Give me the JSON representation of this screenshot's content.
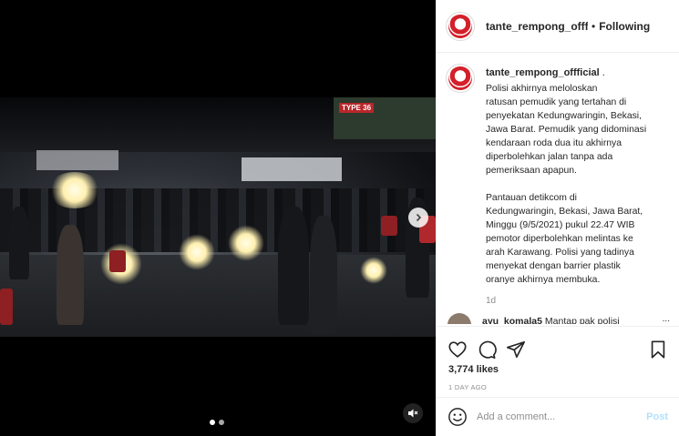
{
  "header": {
    "username": "tante_rempong_offficial",
    "separator": "•",
    "follow_status": "Following"
  },
  "caption": {
    "username": "tante_rempong_offficial",
    "suffix": " .",
    "text": "Polisi akhirnya meloloskan\nratusan pemudik yang tertahan di\npenyekatan Kedungwaringin, Bekasi,\nJawa Barat. Pemudik yang didominasi\nkendaraan roda dua itu akhirnya\ndiperbolehkan jalan tanpa ada\npemeriksaan apapun.\n\nPantauan detikcom di\nKedungwaringin, Bekasi, Jawa Barat,\nMinggu (9/5/2021) pukul 22.47 WIB\npemotor diperbolehkan melintas ke\narah Karawang. Polisi yang tadinya\nmenyekat dengan barrier plastik\noranye akhirnya membuka.",
    "time": "1d"
  },
  "comment_preview": {
    "username": "ayu_komala5",
    "text": "Mantap pak polisi",
    "more": "..."
  },
  "video": {
    "sign_text": "TYPE 36"
  },
  "actions": {
    "likes": "3,774 likes",
    "time_ago": "1 DAY AGO"
  },
  "comment_box": {
    "placeholder": "Add a comment...",
    "post_label": "Post"
  },
  "colors": {
    "accent_blue": "#b2dffc",
    "secondary_text": "#8e8e8e",
    "divider": "#efefef"
  },
  "icons": [
    "chevron-right-icon",
    "mute-icon",
    "heart-icon",
    "comment-icon",
    "share-icon",
    "bookmark-icon",
    "emoji-icon"
  ]
}
